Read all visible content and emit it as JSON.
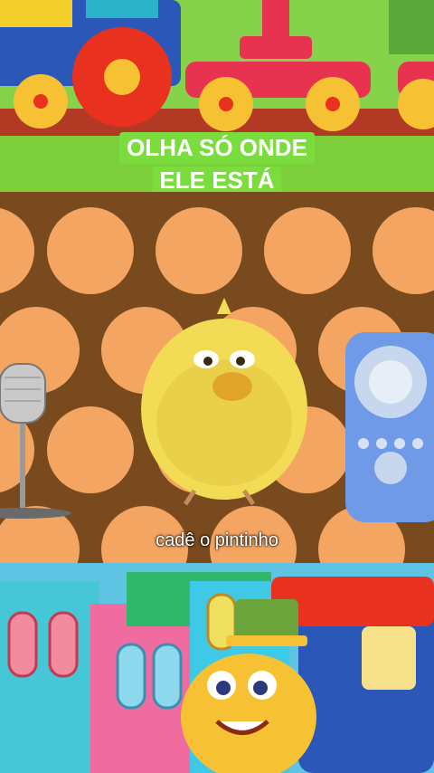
{
  "video": {
    "caption_line1": "OLHA SÓ ONDE",
    "caption_line2": "ELE ESTÁ",
    "subtitle": "cadê o pintinho"
  },
  "colors": {
    "caption_bg": "#7bdc3e",
    "dots": "#f4a562",
    "dots_bg": "#7a4a1f",
    "chick": "#f2dc55"
  }
}
